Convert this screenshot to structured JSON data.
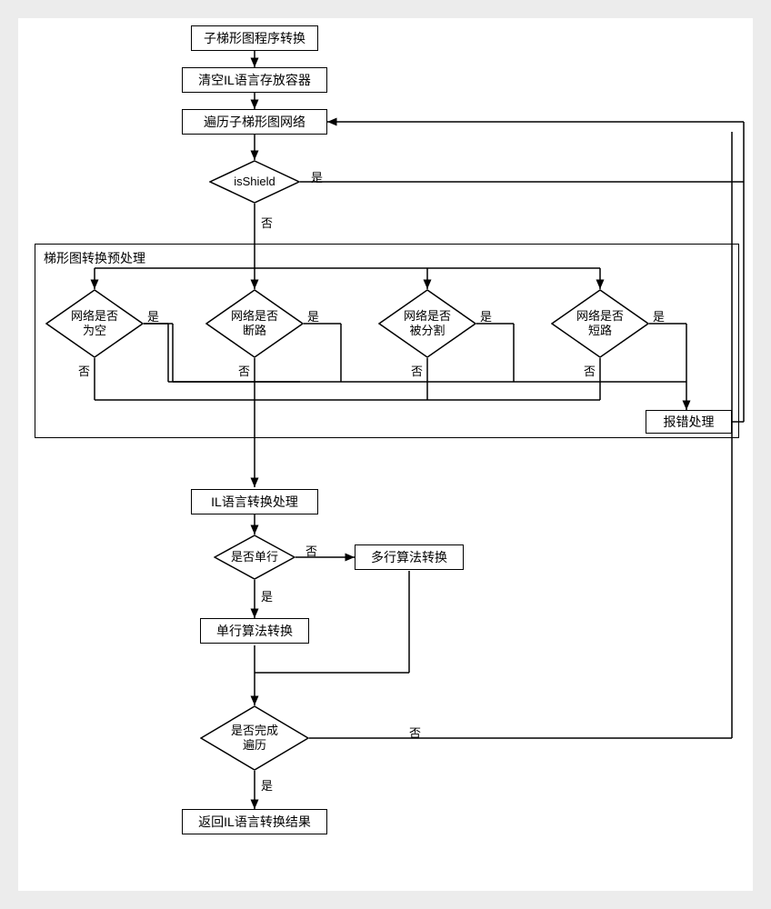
{
  "nodes": {
    "start": "子梯形图程序转换",
    "clear": "清空IL语言存放容器",
    "traverse": "遍历子梯形图网络",
    "isShield": "isShield",
    "preprocLabel": "梯形图转换预处理",
    "isEmpty": "网络是否\n为空",
    "isBroken": "网络是否\n断路",
    "isSplit": "网络是否\n被分割",
    "isShort": "网络是否\n短路",
    "error": "报错处理",
    "ilProcess": "IL语言转换处理",
    "singleLine": "是否单行",
    "multiLine": "多行算法转换",
    "singleConv": "单行算法转换",
    "done": "是否完成\n遍历",
    "result": "返回IL语言转换结果"
  },
  "edges": {
    "yes": "是",
    "no": "否"
  }
}
